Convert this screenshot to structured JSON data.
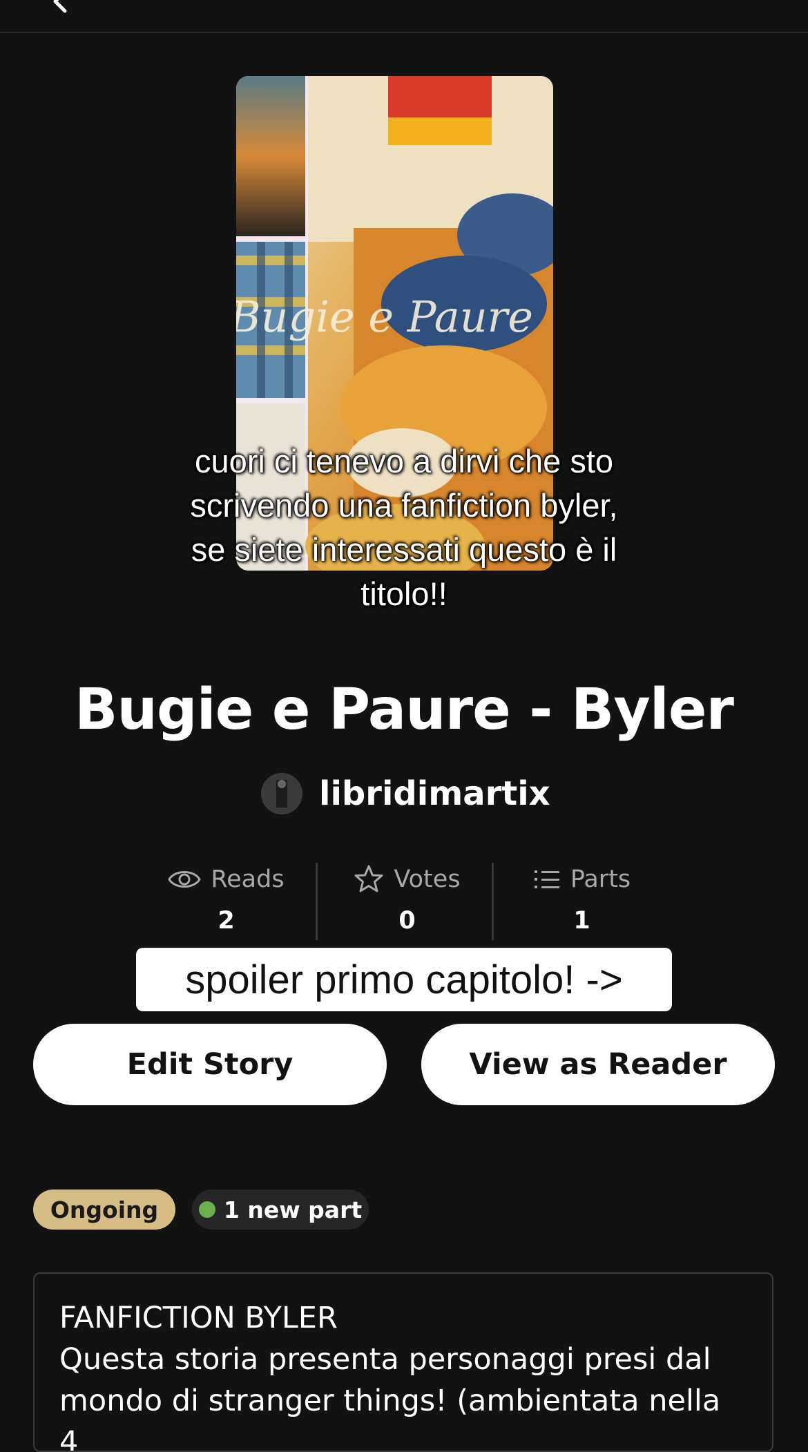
{
  "header": {
    "back_icon": "chevron-left-icon"
  },
  "cover": {
    "title_text": "Bugie e Paure",
    "image_description_colors": {
      "orange": "#d98a2a",
      "blue": "#3b5b8a",
      "cream": "#e8d9b0"
    }
  },
  "overlay_caption": "cuori ci tenevo a dirvi che sto scrivendo una fanfiction byler, se siete interessati questo è il titolo!!",
  "story": {
    "title": "Bugie e Paure - Byler",
    "author": "libridimartix"
  },
  "stats": [
    {
      "icon": "eye-icon",
      "label": "Reads",
      "value": "2"
    },
    {
      "icon": "star-icon",
      "label": "Votes",
      "value": "0"
    },
    {
      "icon": "list-icon",
      "label": "Parts",
      "value": "1"
    }
  ],
  "spoiler_banner": "spoiler primo capitolo! ->",
  "buttons": {
    "edit": "Edit Story",
    "view": "View as Reader"
  },
  "badges": {
    "status": "Ongoing",
    "new_parts": "1 new part"
  },
  "description": {
    "heading": "FANFICTION BYLER",
    "body": "Questa storia presenta personaggi presi dal mondo di stranger things! (ambientata nella 4"
  },
  "colors": {
    "background": "#121212",
    "status_badge": "#d6bd85",
    "new_dot": "#6ab04c"
  }
}
